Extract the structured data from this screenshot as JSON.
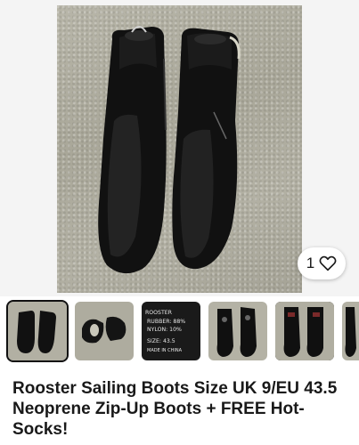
{
  "listing": {
    "title": "Rooster Sailing Boots Size UK 9/EU 43.5 Neoprene Zip-Up Boots + FREE Hot-Socks!",
    "like_count": "1"
  },
  "gallery": {
    "thumbnails": [
      {
        "label": "boots-front",
        "selected": true
      },
      {
        "label": "boots-soles",
        "selected": false
      },
      {
        "label": "size-label",
        "selected": false
      },
      {
        "label": "hot-socks-1",
        "selected": false
      },
      {
        "label": "hot-socks-2",
        "selected": false
      },
      {
        "label": "hot-socks-3",
        "selected": false
      }
    ],
    "label_text": {
      "brand": "ROOSTER",
      "rubber": "RUBBER: 88%",
      "nylon": "NYLON: 10%",
      "size": "SIZE: 43.5",
      "origin": "MADE IN CHINA"
    }
  },
  "colors": {
    "accent": "#191919",
    "background": "#ffffff",
    "carpet": "#b1af a2"
  }
}
